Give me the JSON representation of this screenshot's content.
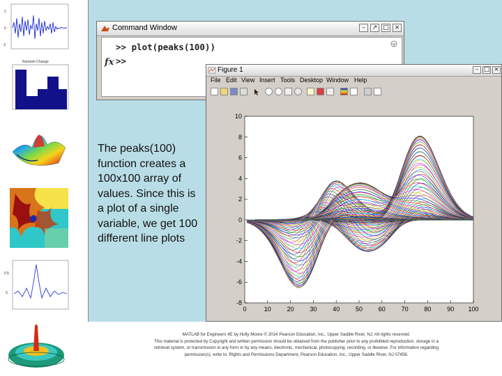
{
  "command_window": {
    "title": "Command Window",
    "command": ">> plot(peaks(100))",
    "prompt": ">>",
    "fx_label": "fx"
  },
  "figure_window": {
    "title": "Figure 1",
    "menu": [
      "File",
      "Edit",
      "View",
      "Insert",
      "Tools",
      "Desktop",
      "Window",
      "Help"
    ]
  },
  "description": "The peaks(100) function creates a 100x100 array of values.  Since this is a plot of a single variable, we get 100 different line plots",
  "footer": {
    "line1": "MATLAB for Engineers 4E  by Holly Moore  © 2014 Pearson Education, Inc., Upper Saddle River, NJ.  All rights reserved.",
    "line2": "This material is protected by Copyright and written permission should be obtained from the publisher prior to any prohibited reproduction, storage in a",
    "line3": "retrieval system, or transmission in any form or by any means, electronic, mechanical, photocopying, recording, or likewise. For information regarding",
    "line4": "permission(s), write to: Rights and Permissions Department, Pearson Education, Inc., Upper Saddle River, NJ 07458."
  },
  "thumbnails": {
    "thumb2_title": "Random Change"
  },
  "chart_data": {
    "type": "line",
    "title": "",
    "xlabel": "",
    "ylabel": "",
    "xlim": [
      0,
      100
    ],
    "ylim": [
      -8,
      10
    ],
    "x_ticks": [
      0,
      10,
      20,
      30,
      40,
      50,
      60,
      70,
      80,
      90,
      100
    ],
    "y_ticks": [
      -8,
      -6,
      -4,
      -2,
      0,
      2,
      4,
      6,
      8,
      10
    ],
    "grid": false,
    "series_count": 100,
    "series_source": "peaks(100) columns"
  }
}
